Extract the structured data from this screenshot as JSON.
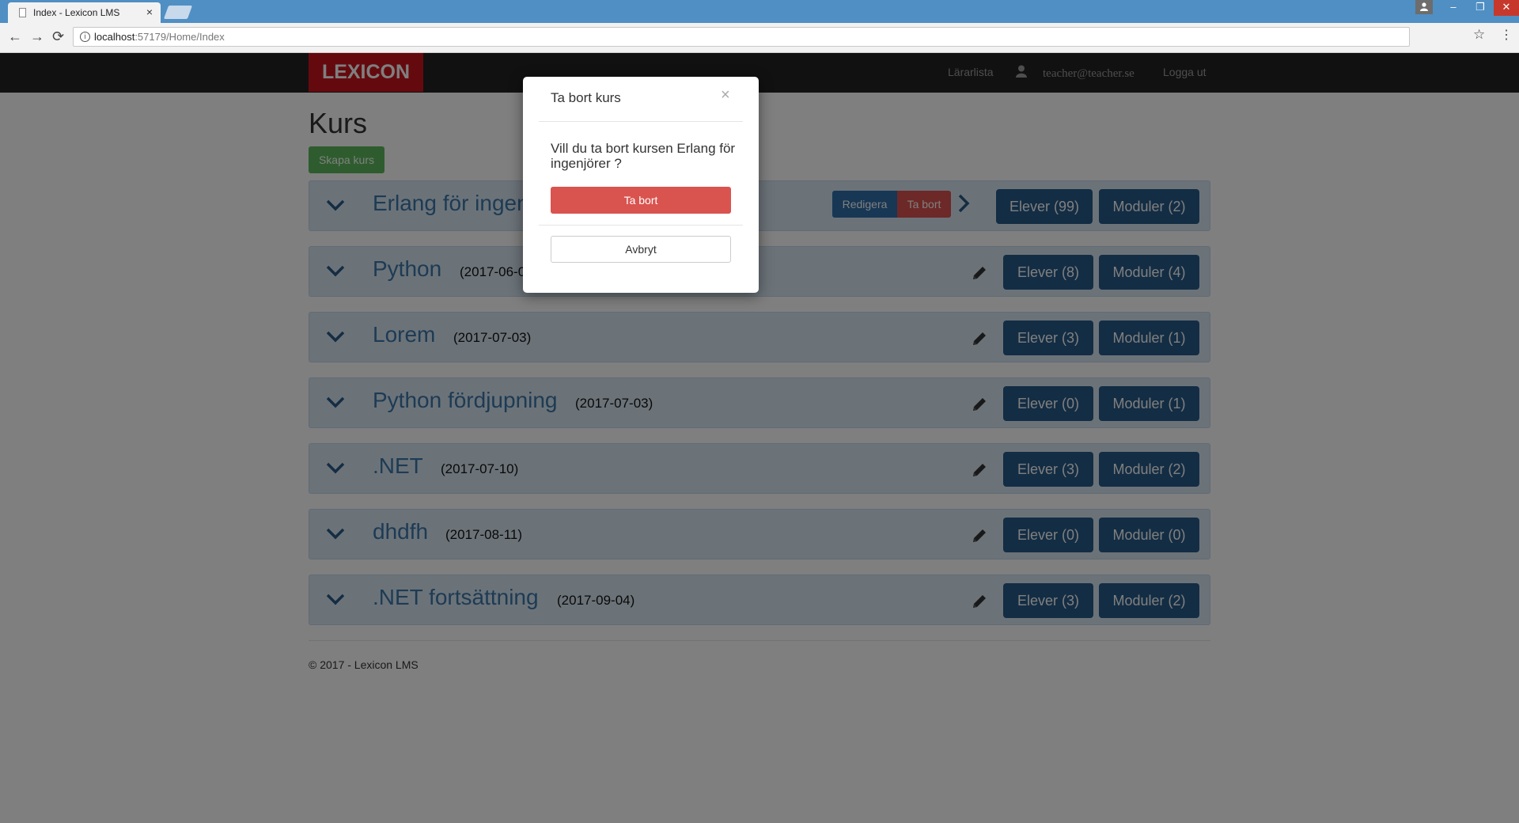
{
  "browser": {
    "tab_title": "Index - Lexicon LMS",
    "tab_close": "×",
    "url_host": "localhost",
    "url_rest": ":57179/Home/Index",
    "window_min": "–",
    "window_max": "❐",
    "window_close": "✕",
    "back": "←",
    "forward": "→",
    "reload": "⟳",
    "star": "☆",
    "menu": "⋮",
    "info": "i"
  },
  "navbar": {
    "brand": "LEXICON",
    "link_teachers": "Lärarlista",
    "user_email": "teacher@teacher.se",
    "logout": "Logga ut"
  },
  "page": {
    "title": "Kurs",
    "create_button": "Skapa kurs"
  },
  "courses": [
    {
      "name": "Erlang för ingenjörer",
      "date": "",
      "edit_label": "Redigera",
      "delete_label": "Ta bort",
      "elever_label": "Elever (99)",
      "moduler_label": "Moduler (2)"
    },
    {
      "name": "Python",
      "date": "(2017-06-0",
      "elever_label": "Elever (8)",
      "moduler_label": "Moduler (4)"
    },
    {
      "name": "Lorem",
      "date": "(2017-07-03)",
      "elever_label": "Elever (3)",
      "moduler_label": "Moduler (1)"
    },
    {
      "name": "Python fördjupning",
      "date": "(2017-07-03)",
      "elever_label": "Elever (0)",
      "moduler_label": "Moduler (1)"
    },
    {
      "name": ".NET",
      "date": "(2017-07-10)",
      "elever_label": "Elever (3)",
      "moduler_label": "Moduler (2)"
    },
    {
      "name": "dhdfh",
      "date": "(2017-08-11)",
      "elever_label": "Elever (0)",
      "moduler_label": "Moduler (0)"
    },
    {
      "name": ".NET fortsättning",
      "date": "(2017-09-04)",
      "elever_label": "Elever (3)",
      "moduler_label": "Moduler (2)"
    }
  ],
  "footer": {
    "text": "© 2017 - Lexicon LMS"
  },
  "modal": {
    "title": "Ta bort kurs",
    "close": "×",
    "message": "Vill du ta bort kursen Erlang för ingenjörer ?",
    "confirm_label": "Ta bort",
    "cancel_label": "Avbryt"
  },
  "colors": {
    "brand": "#c8141e",
    "navbar": "#222222",
    "primary": "#265a88",
    "danger": "#d9534f",
    "success": "#5cb85c",
    "course_bg": "#d6e6f3",
    "course_text": "#3c76a8"
  }
}
